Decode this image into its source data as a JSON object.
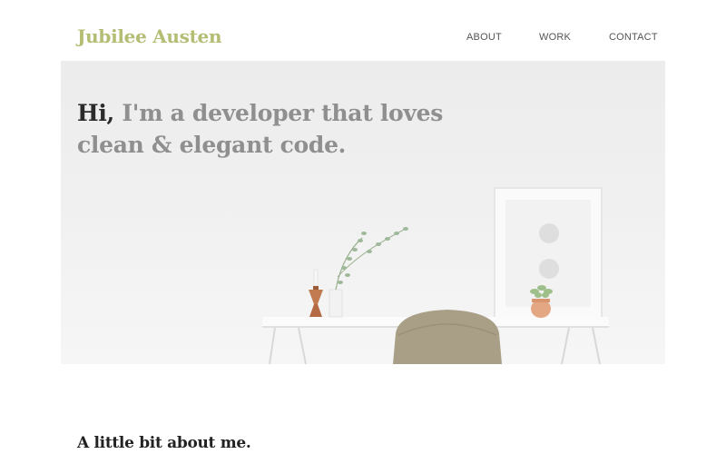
{
  "site": {
    "name": "Jubilee Austen"
  },
  "nav": {
    "items": [
      "ABOUT",
      "WORK",
      "CONTACT"
    ]
  },
  "hero": {
    "greeting": "Hi,",
    "line1_rest": " I'm a developer that loves",
    "line2": "clean & elegant code."
  },
  "about": {
    "heading": "A little bit about me."
  },
  "colors": {
    "brand": "#b4bd73",
    "headline_muted": "#8f8f8f",
    "headline_dark": "#2b2b2b"
  }
}
